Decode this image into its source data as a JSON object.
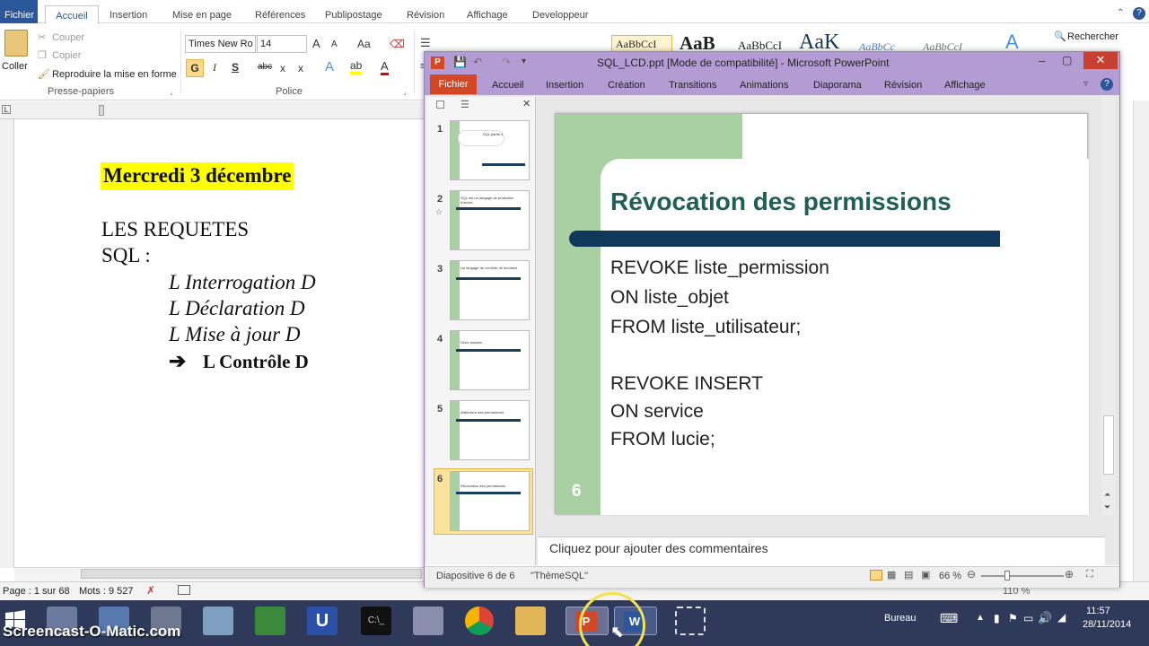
{
  "word": {
    "tabs": [
      "Fichier",
      "Accueil",
      "Insertion",
      "Mise en page",
      "Références",
      "Publipostage",
      "Révision",
      "Affichage",
      "Developpeur"
    ],
    "clipboard": {
      "paste": "Coller",
      "cut": "Couper",
      "copy": "Copier",
      "format_painter": "Reproduire la mise en forme",
      "group": "Presse-papiers"
    },
    "font": {
      "name": "Times New Ro",
      "size": "14",
      "group": "Police",
      "grow": "A",
      "shrink": "A",
      "case": "Aa",
      "bold": "G",
      "italic": "I",
      "underline": "S",
      "strike": "abc",
      "subscript": "x",
      "superscript": "x"
    },
    "styles": {
      "s1": "AaBbCcI",
      "s2": "AaB",
      "s3": "AaBbCcI",
      "s4": "AaK",
      "s5": "AaBbCc",
      "s6": "AaBbCcI"
    },
    "find": "Rechercher",
    "doc": {
      "heading": "Mercredi 3 décembre",
      "line1": "LES REQUETES",
      "line2": "SQL :",
      "item1": "L Interrogation D",
      "item2": "L Déclaration D",
      "item3": "L Mise à jour D",
      "item4": "L Contrôle D",
      "arrow": "➔"
    },
    "status": {
      "page": "Page : 1 sur 68",
      "words": "Mots : 9 527",
      "zoom": "110 %"
    }
  },
  "ppt": {
    "title": "SQL_LCD.ppt [Mode de compatibilité] - Microsoft PowerPoint",
    "tabs": [
      "Fichier",
      "Accueil",
      "Insertion",
      "Création",
      "Transitions",
      "Animations",
      "Diaporama",
      "Révision",
      "Affichage"
    ],
    "thumbs": [
      {
        "num": "1",
        "text": "SQL partie 4"
      },
      {
        "num": "2",
        "text": "SQL est un langage de protection d'accès"
      },
      {
        "num": "3",
        "text": "Un langage de contrôle de données"
      },
      {
        "num": "4",
        "text": "Deux clauses"
      },
      {
        "num": "5",
        "text": "Attribution des permissions"
      },
      {
        "num": "6",
        "text": "Révocation des permissions"
      }
    ],
    "slide": {
      "title": "Révocation des permissions",
      "l1": "REVOKE  liste_permission",
      "l2": "ON liste_objet",
      "l3": "FROM liste_utilisateur;",
      "l4": "REVOKE INSERT",
      "l5": "ON service",
      "l6": "FROM lucie;",
      "num": "6"
    },
    "notes": "Cliquez pour ajouter des commentaires",
    "status": {
      "slide": "Diapositive 6 de 6",
      "theme": "\"ThèmeSQL\"",
      "zoom": "66 %"
    }
  },
  "taskbar": {
    "bureau": "Bureau",
    "time": "11:57",
    "date": "28/11/2014",
    "watermark": "Screencast-O-Matic.com"
  },
  "colors": {
    "word_blue": "#2b579a",
    "ppt_purple": "#b29cd3",
    "ppt_orange": "#d24726",
    "slide_green": "#a9d0a3",
    "slide_bar": "#10385a",
    "slide_title": "#1f5f56"
  }
}
